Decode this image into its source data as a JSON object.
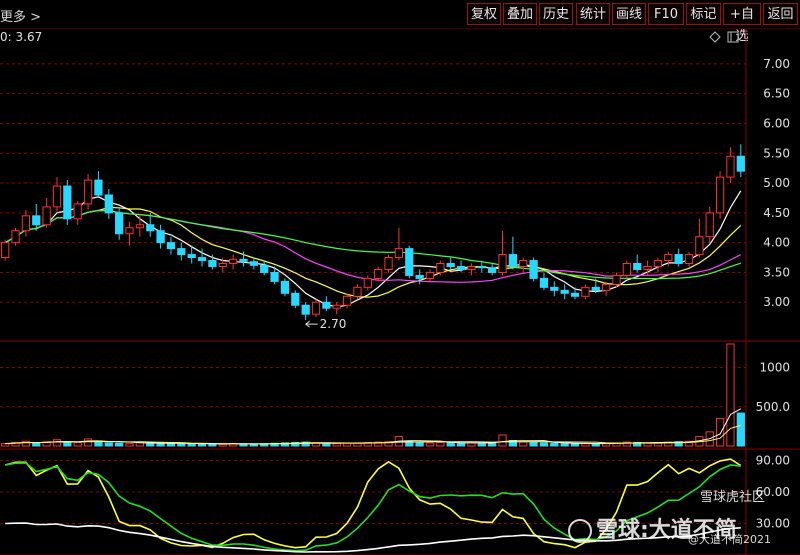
{
  "toolbar": {
    "more_label": "更多 >",
    "buttons": [
      {
        "id": "fuquan",
        "label": "复权"
      },
      {
        "id": "diejia",
        "label": "叠加"
      },
      {
        "id": "lishi",
        "label": "历史"
      },
      {
        "id": "tongji",
        "label": "统计"
      },
      {
        "id": "huaxian",
        "label": "画线"
      },
      {
        "id": "f10",
        "label": "F10"
      },
      {
        "id": "biaoji",
        "label": "标记"
      },
      {
        "id": "zixuan",
        "label": "+自选"
      },
      {
        "id": "fanhui",
        "label": "返回"
      }
    ]
  },
  "price_info": "0: 3.67",
  "low_marker": "2.70",
  "watermark": {
    "brand_top": "雪球虎社区",
    "brand_main": "雪球:大道不简",
    "user": "@大道不简2021"
  },
  "colors": {
    "up": "#ff3030",
    "down": "#28d8ff",
    "grid": "#8a0000",
    "ma5": "#ffffff",
    "ma10": "#ffff40",
    "ma20": "#ff40ff",
    "ma60": "#40ff40",
    "ind_yellow": "#ffff30",
    "ind_green": "#20e020",
    "ind_white": "#ffffff"
  },
  "chart_data": [
    {
      "type": "candlestick",
      "panel": "price",
      "ylim": [
        2.4,
        7.3
      ],
      "yticks": [
        "7.00",
        "6.50",
        "6.00",
        "5.50",
        "5.00",
        "4.50",
        "4.00",
        "3.50",
        "3.00"
      ],
      "ohlc": [
        [
          3.75,
          4.05,
          3.7,
          4.0
        ],
        [
          4.0,
          4.25,
          3.95,
          4.2
        ],
        [
          4.2,
          4.55,
          4.1,
          4.45
        ],
        [
          4.45,
          4.65,
          4.2,
          4.3
        ],
        [
          4.3,
          4.75,
          4.25,
          4.6
        ],
        [
          4.6,
          5.1,
          4.5,
          4.95
        ],
        [
          4.95,
          5.05,
          4.3,
          4.4
        ],
        [
          4.4,
          4.7,
          4.3,
          4.65
        ],
        [
          4.65,
          5.15,
          4.55,
          5.05
        ],
        [
          5.05,
          5.2,
          4.75,
          4.8
        ],
        [
          4.8,
          4.9,
          4.4,
          4.5
        ],
        [
          4.5,
          4.6,
          4.05,
          4.15
        ],
        [
          4.15,
          4.35,
          3.95,
          4.25
        ],
        [
          4.25,
          4.45,
          4.1,
          4.3
        ],
        [
          4.3,
          4.5,
          4.1,
          4.2
        ],
        [
          4.2,
          4.3,
          3.9,
          4.0
        ],
        [
          4.0,
          4.1,
          3.8,
          3.9
        ],
        [
          3.9,
          4.0,
          3.7,
          3.8
        ],
        [
          3.8,
          3.95,
          3.65,
          3.75
        ],
        [
          3.75,
          3.9,
          3.6,
          3.7
        ],
        [
          3.7,
          3.8,
          3.55,
          3.6
        ],
        [
          3.6,
          3.75,
          3.5,
          3.65
        ],
        [
          3.65,
          3.8,
          3.55,
          3.72
        ],
        [
          3.72,
          3.85,
          3.6,
          3.68
        ],
        [
          3.68,
          3.75,
          3.55,
          3.62
        ],
        [
          3.62,
          3.7,
          3.45,
          3.5
        ],
        [
          3.5,
          3.6,
          3.3,
          3.35
        ],
        [
          3.35,
          3.4,
          3.1,
          3.15
        ],
        [
          3.15,
          3.2,
          2.9,
          2.95
        ],
        [
          2.95,
          3.0,
          2.7,
          2.8
        ],
        [
          2.8,
          3.05,
          2.75,
          3.0
        ],
        [
          3.0,
          3.1,
          2.85,
          2.9
        ],
        [
          2.9,
          3.0,
          2.8,
          2.95
        ],
        [
          2.95,
          3.15,
          2.9,
          3.1
        ],
        [
          3.1,
          3.3,
          3.05,
          3.25
        ],
        [
          3.25,
          3.45,
          3.2,
          3.4
        ],
        [
          3.4,
          3.6,
          3.35,
          3.55
        ],
        [
          3.55,
          3.8,
          3.5,
          3.75
        ],
        [
          3.75,
          4.25,
          3.7,
          3.9
        ],
        [
          3.9,
          3.95,
          3.4,
          3.45
        ],
        [
          3.45,
          3.55,
          3.3,
          3.4
        ],
        [
          3.4,
          3.55,
          3.35,
          3.5
        ],
        [
          3.5,
          3.7,
          3.45,
          3.65
        ],
        [
          3.65,
          3.75,
          3.55,
          3.6
        ],
        [
          3.6,
          3.7,
          3.5,
          3.55
        ],
        [
          3.55,
          3.65,
          3.45,
          3.6
        ],
        [
          3.6,
          3.7,
          3.5,
          3.58
        ],
        [
          3.58,
          3.65,
          3.45,
          3.5
        ],
        [
          3.5,
          4.2,
          3.45,
          3.8
        ],
        [
          3.8,
          4.1,
          3.55,
          3.6
        ],
        [
          3.6,
          3.75,
          3.5,
          3.7
        ],
        [
          3.7,
          3.75,
          3.35,
          3.4
        ],
        [
          3.4,
          3.5,
          3.2,
          3.25
        ],
        [
          3.25,
          3.35,
          3.1,
          3.2
        ],
        [
          3.2,
          3.3,
          3.05,
          3.15
        ],
        [
          3.15,
          3.25,
          3.05,
          3.1
        ],
        [
          3.1,
          3.3,
          3.05,
          3.25
        ],
        [
          3.25,
          3.4,
          3.15,
          3.2
        ],
        [
          3.2,
          3.35,
          3.1,
          3.3
        ],
        [
          3.3,
          3.5,
          3.25,
          3.45
        ],
        [
          3.45,
          3.7,
          3.4,
          3.65
        ],
        [
          3.65,
          3.8,
          3.5,
          3.55
        ],
        [
          3.55,
          3.7,
          3.45,
          3.6
        ],
        [
          3.6,
          3.75,
          3.5,
          3.7
        ],
        [
          3.7,
          3.85,
          3.6,
          3.8
        ],
        [
          3.8,
          3.9,
          3.6,
          3.65
        ],
        [
          3.65,
          3.85,
          3.6,
          3.8
        ],
        [
          3.8,
          4.4,
          3.75,
          4.1
        ],
        [
          4.1,
          4.6,
          4.0,
          4.5
        ],
        [
          4.5,
          5.2,
          4.4,
          5.1
        ],
        [
          5.1,
          5.6,
          5.0,
          5.45
        ],
        [
          5.45,
          5.65,
          5.1,
          5.2
        ]
      ]
    },
    {
      "type": "bar",
      "panel": "volume",
      "ylim": [
        0,
        1300
      ],
      "yticks": [
        "1000",
        "500.0"
      ],
      "values": [
        30,
        45,
        60,
        40,
        55,
        80,
        50,
        45,
        90,
        60,
        40,
        35,
        30,
        45,
        40,
        35,
        30,
        25,
        28,
        30,
        25,
        22,
        30,
        28,
        26,
        30,
        35,
        40,
        45,
        50,
        40,
        35,
        30,
        35,
        40,
        45,
        50,
        55,
        120,
        60,
        45,
        40,
        45,
        40,
        35,
        40,
        38,
        35,
        140,
        70,
        50,
        45,
        40,
        35,
        30,
        28,
        30,
        32,
        35,
        40,
        50,
        45,
        40,
        45,
        50,
        55,
        60,
        120,
        180,
        350,
        1300,
        420
      ]
    },
    {
      "type": "line",
      "panel": "indicator",
      "ylim": [
        0,
        100
      ],
      "yticks": [
        "90.00",
        "60.00",
        "30.00"
      ]
    }
  ]
}
